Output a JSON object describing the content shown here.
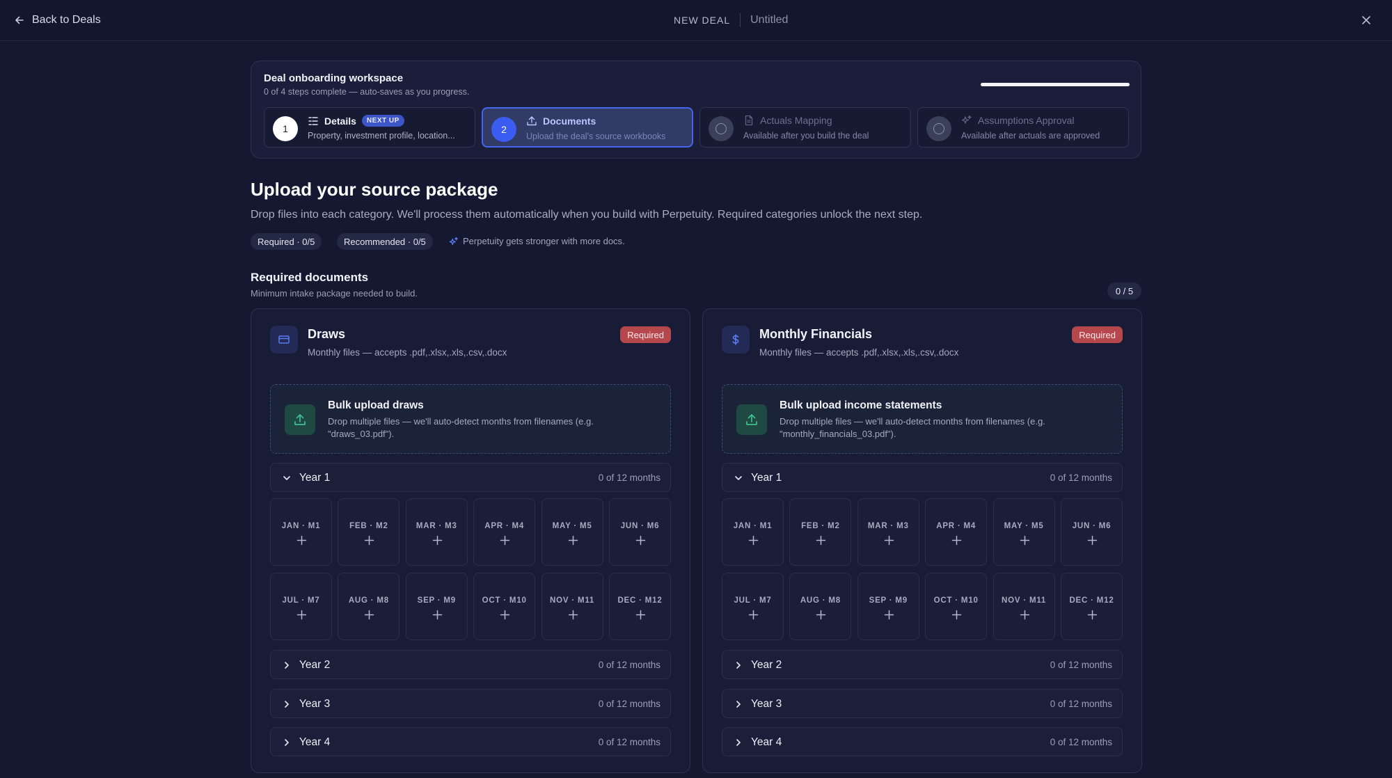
{
  "topbar": {
    "back_label": "Back to Deals",
    "section_label": "NEW DEAL",
    "deal_name": "Untitled"
  },
  "onboarding": {
    "title": "Deal onboarding workspace",
    "subtitle": "0 of 4 steps complete — auto-saves as you progress.",
    "progress_fraction": 0,
    "steps": [
      {
        "number": "1",
        "label": "Details",
        "badge": "NEXT UP",
        "desc": "Property, investment profile, location...",
        "icon": "list-icon",
        "state": "next-up"
      },
      {
        "number": "2",
        "label": "Documents",
        "desc": "Upload the deal's source workbooks",
        "icon": "upload-icon",
        "state": "active"
      },
      {
        "number": "",
        "label": "Actuals Mapping",
        "desc": "Available after you build the deal",
        "icon": "document-icon",
        "state": "locked"
      },
      {
        "number": "",
        "label": "Assumptions Approval",
        "desc": "Available after actuals are approved",
        "icon": "sparkle-icon",
        "state": "locked"
      }
    ]
  },
  "heading": {
    "title": "Upload your source package",
    "lead": "Drop files into each category. We'll process them automatically when you build with Perpetuity. Required categories unlock the next step.",
    "required_pill": "Required · 0/5",
    "recommended_pill": "Recommended · 0/5",
    "tip": "Perpetuity gets stronger with more docs."
  },
  "required_section": {
    "title": "Required documents",
    "subtitle": "Minimum intake package needed to build.",
    "count": "0 / 5"
  },
  "months": [
    "JAN · M1",
    "FEB · M2",
    "MAR · M3",
    "APR · M4",
    "MAY · M5",
    "JUN · M6",
    "JUL · M7",
    "AUG · M8",
    "SEP · M9",
    "OCT · M10",
    "NOV · M11",
    "DEC · M12"
  ],
  "cards": [
    {
      "title": "Draws",
      "subtitle": "Monthly files — accepts .pdf,.xlsx,.xls,.csv,.docx",
      "badge": "Required",
      "icon": "card-icon",
      "bulk_title": "Bulk upload draws",
      "bulk_desc": "Drop multiple files — we'll auto-detect months from filenames (e.g. \"draws_03.pdf\").",
      "years": [
        {
          "label": "Year 1",
          "count": "0 of 12 months",
          "expanded": true
        },
        {
          "label": "Year 2",
          "count": "0 of 12 months",
          "expanded": false
        },
        {
          "label": "Year 3",
          "count": "0 of 12 months",
          "expanded": false
        },
        {
          "label": "Year 4",
          "count": "0 of 12 months",
          "expanded": false
        }
      ]
    },
    {
      "title": "Monthly Financials",
      "subtitle": "Monthly files — accepts .pdf,.xlsx,.xls,.csv,.docx",
      "badge": "Required",
      "icon": "dollar-icon",
      "bulk_title": "Bulk upload income statements",
      "bulk_desc": "Drop multiple files — we'll auto-detect months from filenames (e.g. \"monthly_financials_03.pdf\").",
      "years": [
        {
          "label": "Year 1",
          "count": "0 of 12 months",
          "expanded": true
        },
        {
          "label": "Year 2",
          "count": "0 of 12 months",
          "expanded": false
        },
        {
          "label": "Year 3",
          "count": "0 of 12 months",
          "expanded": false
        },
        {
          "label": "Year 4",
          "count": "0 of 12 months",
          "expanded": false
        }
      ]
    }
  ],
  "colors": {
    "background": "#141831",
    "accent": "#3b5cf0",
    "required_badge": "#b5474d",
    "upload_green": "#3fbf8f"
  }
}
